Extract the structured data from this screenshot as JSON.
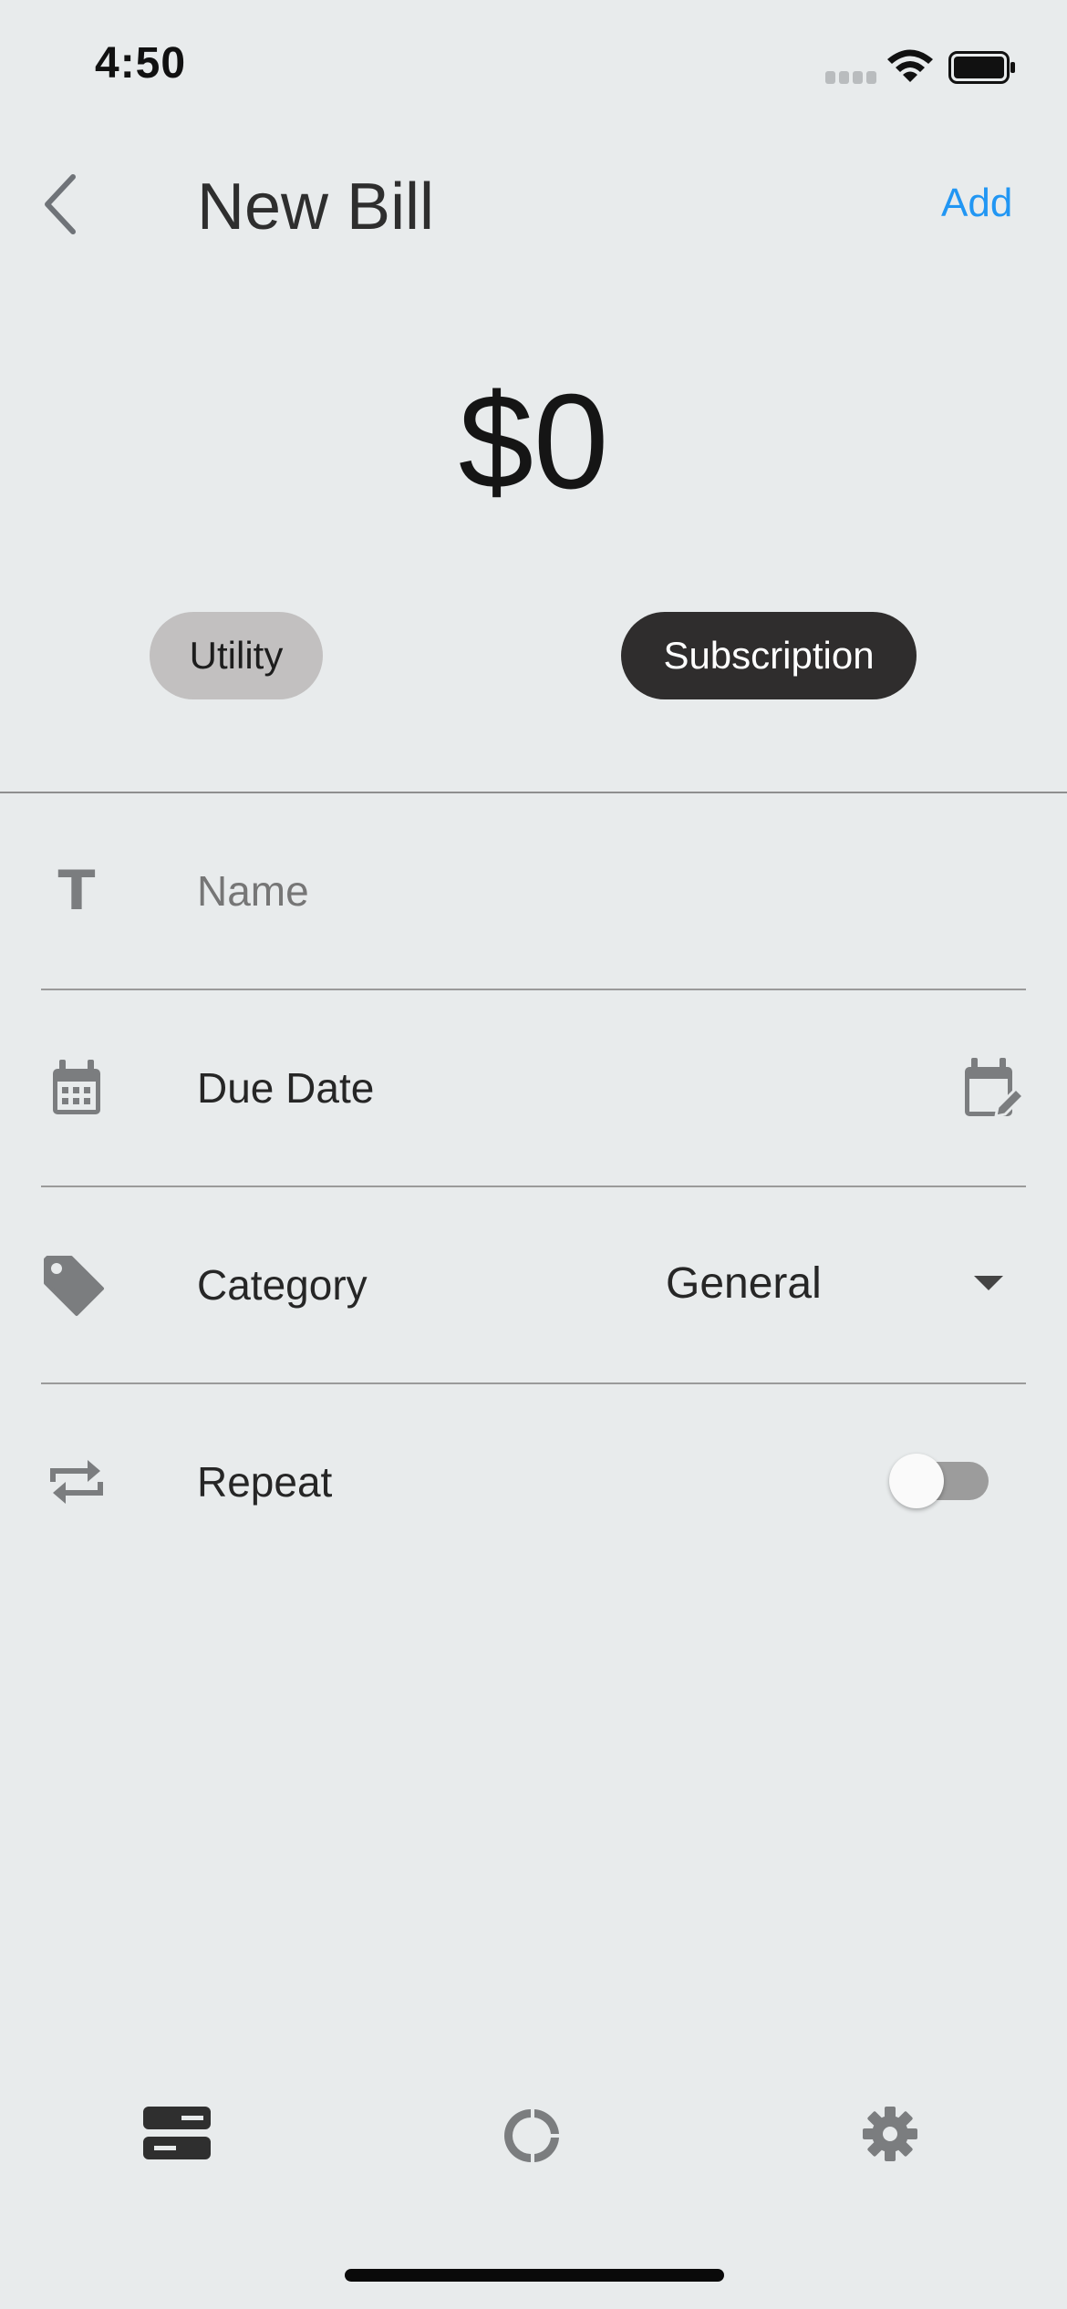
{
  "status_bar": {
    "time": "4:50"
  },
  "header": {
    "title": "New Bill",
    "add_label": "Add"
  },
  "amount": {
    "value": "$0"
  },
  "bill_types": [
    {
      "label": "Utility",
      "selected": false
    },
    {
      "label": "Subscription",
      "selected": true
    }
  ],
  "form": {
    "name": {
      "placeholder": "Name",
      "value": ""
    },
    "due_date": {
      "label": "Due Date"
    },
    "category": {
      "label": "Category",
      "selected": "General"
    },
    "repeat": {
      "label": "Repeat",
      "enabled": false
    }
  },
  "bottom_nav": [
    {
      "icon": "bills-icon",
      "active": true
    },
    {
      "icon": "chart-icon",
      "active": false
    },
    {
      "icon": "settings-icon",
      "active": false
    }
  ],
  "colors": {
    "accent": "#2196F3",
    "background": "#E8EBEC",
    "selected_chip": "#2F2D2D",
    "unselected_chip": "#C2C0C0"
  }
}
